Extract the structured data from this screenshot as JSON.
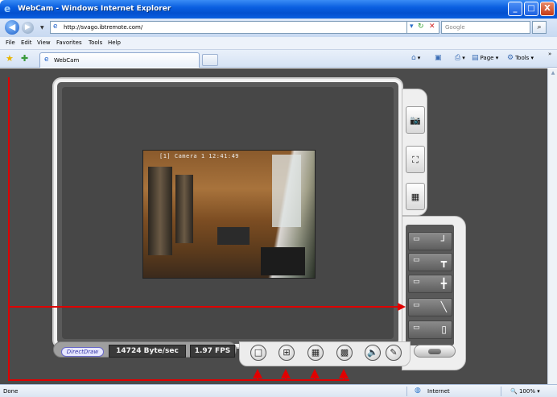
{
  "window": {
    "title": "WebCam - Windows Internet Explorer",
    "min_label": "_",
    "max_label": "□",
    "close_label": "X"
  },
  "nav": {
    "back_icon": "◀",
    "forward_icon": "▶",
    "address": "http://svago.ibtremote.com/",
    "search_placeholder": "Google",
    "refresh_icon": "↻",
    "stop_icon": "✕",
    "search_icon": "⌕"
  },
  "menu": [
    "File",
    "Edit",
    "View",
    "Favorites",
    "Tools",
    "Help"
  ],
  "tabs": {
    "active_label": "WebCam"
  },
  "command_bar": {
    "page_label": "Page",
    "tools_label": "Tools",
    "more_label": "»"
  },
  "viewer": {
    "camera_overlay": "[1] Camera 1  12:41:49",
    "render_mode": "DirectDraw",
    "bitrate": "14724 Byte/sec",
    "fps": "1.97 FPS"
  },
  "status": {
    "left": "Done",
    "zone": "Internet",
    "zoom": "100%"
  },
  "colors": {
    "annotation": "#e00000",
    "titlebar": "#0a5fe0"
  }
}
